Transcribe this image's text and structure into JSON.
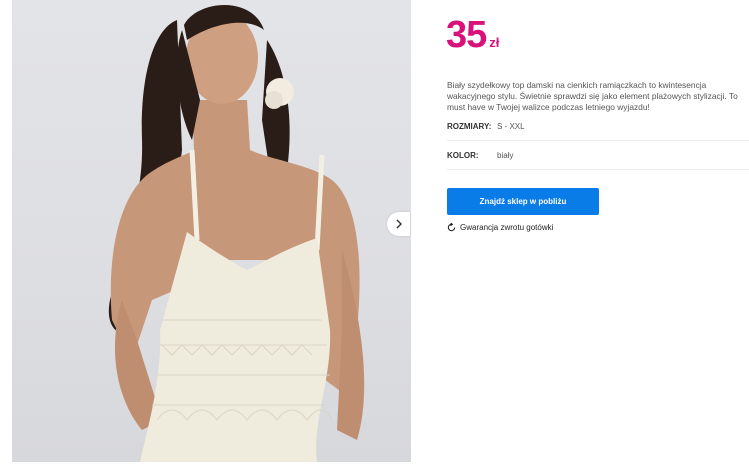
{
  "product": {
    "price": "35",
    "currency": "zł",
    "top_cut_text": "...",
    "description": "Biały szydełkowy top damski na cienkich ramiączkach to kwintesencja wakacyjnego stylu. Świetnie sprawdzi się jako element plażowych stylizacji. To must have w Twojej walizce podczas letniego wyjazdu!",
    "sizes": {
      "label": "ROZMIARY:",
      "value": "S - XXL"
    },
    "color": {
      "label": "KOLOR:",
      "value": "biały"
    },
    "find_store_label": "Znajdź sklep w pobliżu",
    "guarantee_label": "Gwarancja zwrotu gotówki"
  },
  "gallery": {
    "next_icon": "chevron-right-icon",
    "image": "woman wearing white crochet top"
  },
  "colors": {
    "price": "#d9117a",
    "button": "#0a7ce8"
  }
}
